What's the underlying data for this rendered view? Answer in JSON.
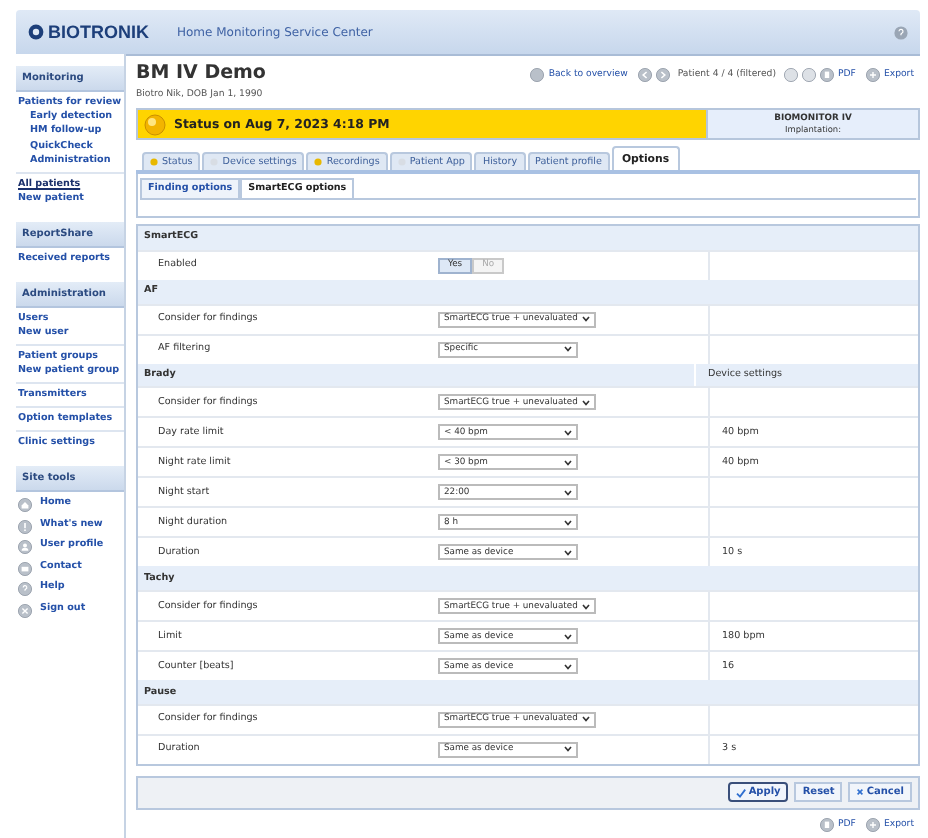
{
  "header": {
    "logo": "BIOTRONIK",
    "title": "Home Monitoring Service Center"
  },
  "sidebar": {
    "sections": [
      {
        "title": "Monitoring",
        "groups": [
          [
            {
              "label": "Patients for review",
              "kind": "link",
              "selected": false
            },
            {
              "label": "Early detection",
              "kind": "sublink",
              "selected": false
            },
            {
              "label": "HM follow-up",
              "kind": "sublink",
              "selected": false
            },
            {
              "label": "QuickCheck",
              "kind": "sublink",
              "selected": false
            },
            {
              "label": "Administration",
              "kind": "sublink",
              "selected": false
            }
          ],
          [
            {
              "label": "All patients",
              "kind": "link",
              "selected": true
            },
            {
              "label": "New patient",
              "kind": "link",
              "selected": false
            }
          ]
        ]
      },
      {
        "title": "ReportShare",
        "groups": [
          [
            {
              "label": "Received reports",
              "kind": "link",
              "selected": false
            }
          ]
        ]
      },
      {
        "title": "Administration",
        "groups": [
          [
            {
              "label": "Users",
              "kind": "link",
              "selected": false
            },
            {
              "label": "New user",
              "kind": "link",
              "selected": false
            }
          ],
          [
            {
              "label": "Patient groups",
              "kind": "link",
              "selected": false
            },
            {
              "label": "New patient group",
              "kind": "link",
              "selected": false
            }
          ],
          [
            {
              "label": "Transmitters",
              "kind": "link",
              "selected": false
            }
          ],
          [
            {
              "label": "Option templates",
              "kind": "link",
              "selected": false
            }
          ],
          [
            {
              "label": "Clinic settings",
              "kind": "link",
              "selected": false
            }
          ]
        ]
      },
      {
        "title": "Site tools",
        "groups": [
          [
            {
              "label": "Home",
              "kind": "tool",
              "selected": false
            },
            {
              "label": "What's new",
              "kind": "tool",
              "selected": false
            },
            {
              "label": "User profile",
              "kind": "tool",
              "selected": false
            },
            {
              "label": "Contact",
              "kind": "tool",
              "selected": false
            },
            {
              "label": "Help",
              "kind": "tool",
              "selected": false
            },
            {
              "label": "Sign out",
              "kind": "tool",
              "selected": false
            }
          ]
        ]
      }
    ]
  },
  "patient": {
    "name": "BM IV Demo",
    "details": "Biotro Nik, DOB Jan 1, 1990"
  },
  "nav": {
    "back": "Back to overview",
    "position": "Patient 4 / 4 (filtered)",
    "pdf": "PDF",
    "export": "Export"
  },
  "status": {
    "text": "Status on Aug 7, 2023 4:18 PM",
    "device": "BIOMONITOR IV",
    "implantation": "Implantation:"
  },
  "tabs": [
    {
      "label": "Status",
      "selected": false,
      "color": "#e8b800"
    },
    {
      "label": "Device settings",
      "selected": false,
      "color": "#d8dde4"
    },
    {
      "label": "Recordings",
      "selected": false,
      "color": "#e8b800"
    },
    {
      "label": "Patient App",
      "selected": false,
      "color": "#d8dde4"
    },
    {
      "label": "History",
      "selected": false
    },
    {
      "label": "Patient profile",
      "selected": false
    },
    {
      "label": "Options",
      "selected": true
    }
  ],
  "subtabs": [
    {
      "label": "Finding options",
      "selected": false
    },
    {
      "label": "SmartECG options",
      "selected": true
    }
  ],
  "settings": [
    {
      "title": "SmartECG",
      "rows": [
        {
          "label": "Enabled",
          "kind": "toggle",
          "options": [
            {
              "label": "Yes",
              "selected": true
            },
            {
              "label": "No",
              "selected": false
            }
          ]
        }
      ]
    },
    {
      "title": "AF",
      "rows": [
        {
          "label": "Consider for findings",
          "kind": "select",
          "value": "SmartECG true + unevaluated"
        },
        {
          "label": "AF filtering",
          "kind": "select",
          "value": "Specific"
        }
      ]
    },
    {
      "title": "Brady",
      "device_header": "Device settings",
      "rows": [
        {
          "label": "Consider for findings",
          "kind": "select",
          "value": "SmartECG true + unevaluated"
        },
        {
          "label": "Day rate limit",
          "kind": "select",
          "value": "< 40 bpm",
          "device": "40 bpm"
        },
        {
          "label": "Night rate limit",
          "kind": "select",
          "value": "< 30 bpm",
          "device": "40 bpm"
        },
        {
          "label": "Night start",
          "kind": "select",
          "value": "22:00"
        },
        {
          "label": "Night duration",
          "kind": "select",
          "value": "8 h"
        },
        {
          "label": "Duration",
          "kind": "select",
          "value": "Same as device",
          "device": "10 s"
        }
      ]
    },
    {
      "title": "Tachy",
      "rows": [
        {
          "label": "Consider for findings",
          "kind": "select",
          "value": "SmartECG true + unevaluated"
        },
        {
          "label": "Limit",
          "kind": "select",
          "value": "Same as device",
          "device": "180 bpm"
        },
        {
          "label": "Counter [beats]",
          "kind": "select",
          "value": "Same as device",
          "device": "16"
        }
      ]
    },
    {
      "title": "Pause",
      "rows": [
        {
          "label": "Consider for findings",
          "kind": "select",
          "value": "SmartECG true + unevaluated"
        },
        {
          "label": "Duration",
          "kind": "select",
          "value": "Same as device",
          "device": "3 s"
        }
      ]
    }
  ],
  "actions": [
    {
      "label": "Apply",
      "kind": "apply",
      "selected": true
    },
    {
      "label": "Reset",
      "kind": "plain",
      "selected": false
    },
    {
      "label": "Cancel",
      "kind": "cancel",
      "selected": false
    }
  ],
  "footer": {
    "pdf": "PDF",
    "export": "Export"
  }
}
